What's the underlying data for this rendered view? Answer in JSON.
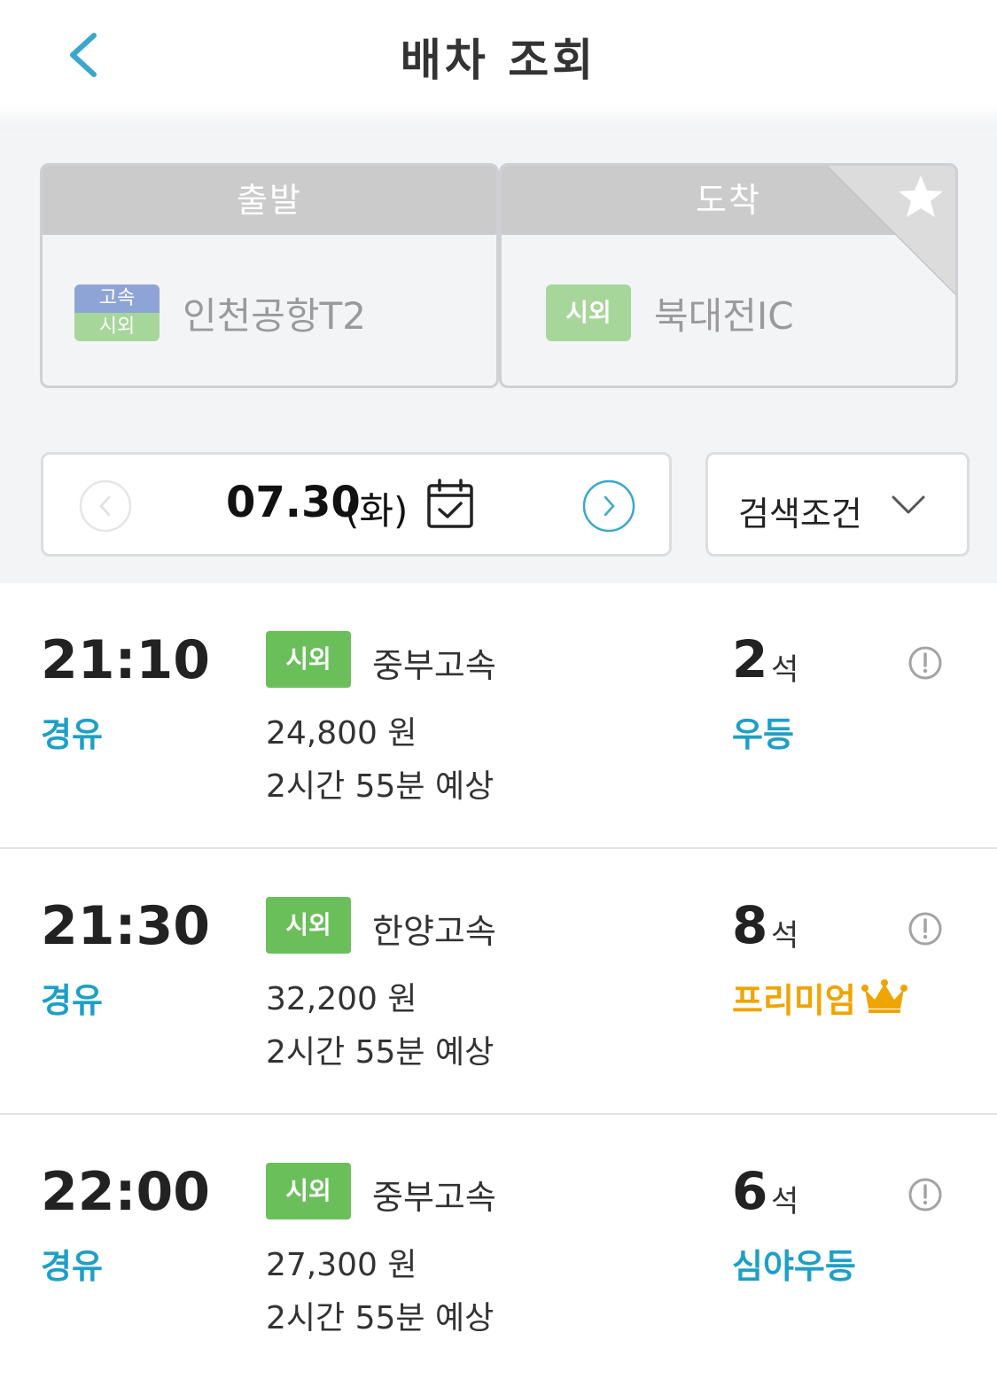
{
  "header": {
    "title": "배차 조회",
    "back_icon": "chevron-left-icon"
  },
  "route": {
    "departure": {
      "header_label": "출발",
      "badge_top": "고속",
      "badge_bottom": "시외",
      "terminal": "인천공항T2"
    },
    "arrival": {
      "header_label": "도착",
      "badge": "시외",
      "terminal": "북대전IC"
    },
    "favorite_icon": "star-icon"
  },
  "date_bar": {
    "date": "07.30",
    "day": "(화)",
    "prev_icon": "chevron-left-circle-icon",
    "next_icon": "chevron-right-circle-icon",
    "calendar_icon": "calendar-check-icon",
    "filter_label": "검색조건",
    "filter_icon": "chevron-down-icon"
  },
  "schedules": [
    {
      "time": "21:10",
      "via": "경유",
      "grade": "시외",
      "company": "중부고속",
      "fare": "24,800 원",
      "duration": "2시간 55분 예상",
      "seats": "2",
      "seat_unit": "석",
      "bus_class": "우등",
      "bus_class_color": "#1e9fc6",
      "premium": false
    },
    {
      "time": "21:30",
      "via": "경유",
      "grade": "시외",
      "company": "한양고속",
      "fare": "32,200 원",
      "duration": "2시간 55분 예상",
      "seats": "8",
      "seat_unit": "석",
      "bus_class": "프리미엄",
      "bus_class_color": "#f0a400",
      "premium": true
    },
    {
      "time": "22:00",
      "via": "경유",
      "grade": "시외",
      "company": "중부고속",
      "fare": "27,300 원",
      "duration": "2시간 55분 예상",
      "seats": "6",
      "seat_unit": "석",
      "bus_class": "심야우등",
      "bus_class_color": "#1e9fc6",
      "premium": false
    }
  ],
  "colors": {
    "accent": "#1e9fc6",
    "grade_green": "#6bbf5a",
    "premium": "#f0a400"
  }
}
